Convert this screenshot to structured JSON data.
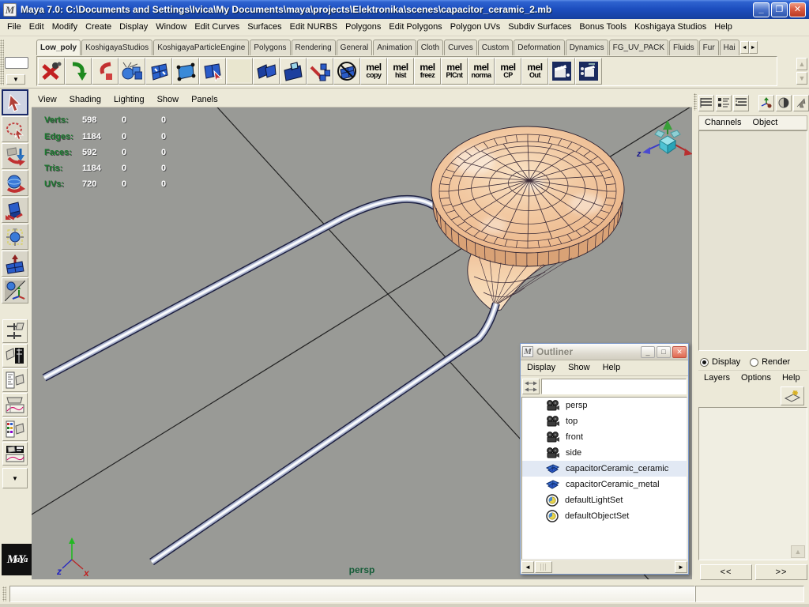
{
  "window": {
    "title": "Maya 7.0: C:\\Documents and Settings\\Ivica\\My Documents\\maya\\projects\\Elektronika\\scenes\\capacitor_ceramic_2.mb"
  },
  "icons": {
    "minimize": "_",
    "restore": "❐",
    "close": "✕",
    "dropdown_arrow": "▼",
    "scroll_left": "◄",
    "scroll_right": "►",
    "scroll_up": "▲",
    "scroll_down": "▼",
    "chevron_down": "❯❯"
  },
  "menu_bar": {
    "items": [
      "File",
      "Edit",
      "Modify",
      "Create",
      "Display",
      "Window",
      "Edit Curves",
      "Surfaces",
      "Edit NURBS",
      "Polygons",
      "Edit Polygons",
      "Polygon UVs",
      "Subdiv Surfaces",
      "Bonus Tools",
      "Koshigaya Studios",
      "Help"
    ]
  },
  "shelf": {
    "tabs": [
      "Low_poly",
      "KoshigayaStudios",
      "KoshigayaParticleEngine",
      "Polygons",
      "Rendering",
      "General",
      "Animation",
      "Cloth",
      "Curves",
      "Custom",
      "Deformation",
      "Dynamics",
      "FG_UV_PACK",
      "Fluids",
      "Fur",
      "Hai"
    ],
    "active_tab": "Low_poly",
    "mel_buttons": [
      [
        "mel",
        "copy"
      ],
      [
        "mel",
        "hist"
      ],
      [
        "mel",
        "freez"
      ],
      [
        "mel",
        "PlCnt"
      ],
      [
        "mel",
        "norma"
      ],
      [
        "mel",
        "CP"
      ],
      [
        "mel",
        "Out"
      ]
    ]
  },
  "panel_menu": {
    "items": [
      "View",
      "Shading",
      "Lighting",
      "Show",
      "Panels"
    ]
  },
  "hud": {
    "rows": [
      {
        "label": "Verts:",
        "c1": "598",
        "c2": "0",
        "c3": "0"
      },
      {
        "label": "Edges:",
        "c1": "1184",
        "c2": "0",
        "c3": "0"
      },
      {
        "label": "Faces:",
        "c1": "592",
        "c2": "0",
        "c3": "0"
      },
      {
        "label": "Tris:",
        "c1": "1184",
        "c2": "0",
        "c3": "0"
      },
      {
        "label": "UVs:",
        "c1": "720",
        "c2": "0",
        "c3": "0"
      }
    ]
  },
  "viewport": {
    "camera_label": "persp",
    "axis": {
      "x": "x",
      "z": "z"
    },
    "gizmo": {
      "x": "x",
      "z": "z"
    }
  },
  "outliner": {
    "title": "Outliner",
    "menu": [
      "Display",
      "Show",
      "Help"
    ],
    "search_value": "",
    "items": [
      {
        "label": "persp",
        "icon": "camera-icon"
      },
      {
        "label": "top",
        "icon": "camera-icon"
      },
      {
        "label": "front",
        "icon": "camera-icon"
      },
      {
        "label": "side",
        "icon": "camera-icon"
      },
      {
        "label": "capacitorCeramic_ceramic",
        "icon": "poly-mesh-icon"
      },
      {
        "label": "capacitorCeramic_metal",
        "icon": "poly-mesh-icon"
      },
      {
        "label": "defaultLightSet",
        "icon": "set-icon"
      },
      {
        "label": "defaultObjectSet",
        "icon": "set-icon"
      }
    ]
  },
  "channel_box": {
    "menu": [
      "Channels",
      "Object"
    ]
  },
  "layer_editor": {
    "radios": [
      "Display",
      "Render"
    ],
    "selected_radio": "Display",
    "menu": [
      "Layers",
      "Options",
      "Help"
    ]
  },
  "nav_buttons": {
    "prev": "<<",
    "next": ">>"
  }
}
